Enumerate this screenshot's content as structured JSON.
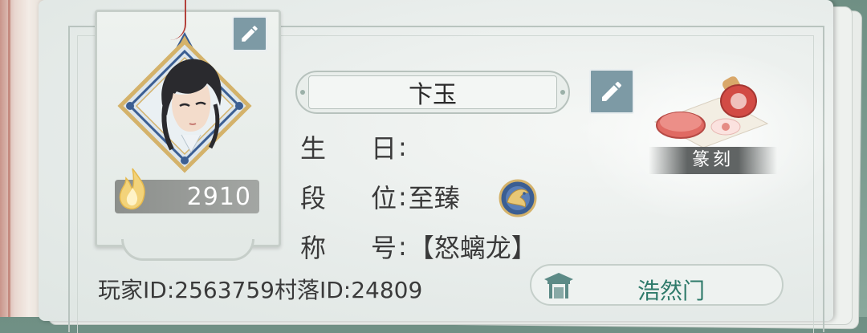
{
  "profile": {
    "player_name": "卞玉",
    "power": "2910",
    "birthday_label": [
      "生",
      "日"
    ],
    "birthday_value": "",
    "rank_label": [
      "段",
      "位"
    ],
    "rank_value": "至臻",
    "title_label": [
      "称",
      "号"
    ],
    "title_value": "【怒螭龙】",
    "colon": ":"
  },
  "ids": {
    "player_id_label": "玩家ID:",
    "player_id": "2563759",
    "village_id_label": "村落ID:",
    "village_id": "24809"
  },
  "sect": {
    "name": "浩然门"
  },
  "seal": {
    "label": "篆刻"
  },
  "icons": {
    "avatar_edit": "pencil-icon",
    "name_edit": "pencil-icon",
    "power": "flame-icon",
    "rank": "dragon-badge-icon",
    "sect": "gate-icon"
  },
  "colors": {
    "accent_blue": "#7d9aa5",
    "sect_text": "#2e7a6a",
    "avatar_gold": "#d4b26a",
    "avatar_blue": "#3b5e92"
  }
}
